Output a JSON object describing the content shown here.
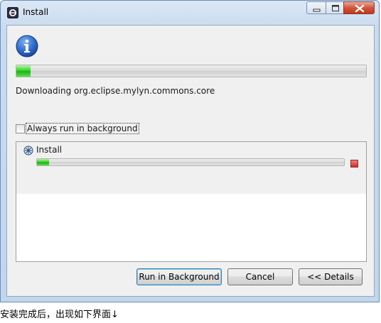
{
  "window": {
    "title": "Install"
  },
  "main": {
    "status_text": "Downloading org.eclipse.mylyn.commons.core",
    "overall_progress": 0.04,
    "always_background_label": "Always run in background",
    "always_background_checked": false
  },
  "jobs": [
    {
      "name": "Install",
      "progress": 0.04
    }
  ],
  "buttons": {
    "run_in_background": "Run in Background",
    "cancel": "Cancel",
    "details": "<< Details"
  },
  "icons": {
    "app": "eclipse-icon",
    "info": "info-icon",
    "job": "install-job-icon",
    "stop": "stop-icon"
  },
  "colors": {
    "progress_fill": "#37d42a",
    "info_blue": "#1f5fbf",
    "stop_red": "#d22b2b"
  },
  "caption": "安装完成后，出现如下界面↓"
}
